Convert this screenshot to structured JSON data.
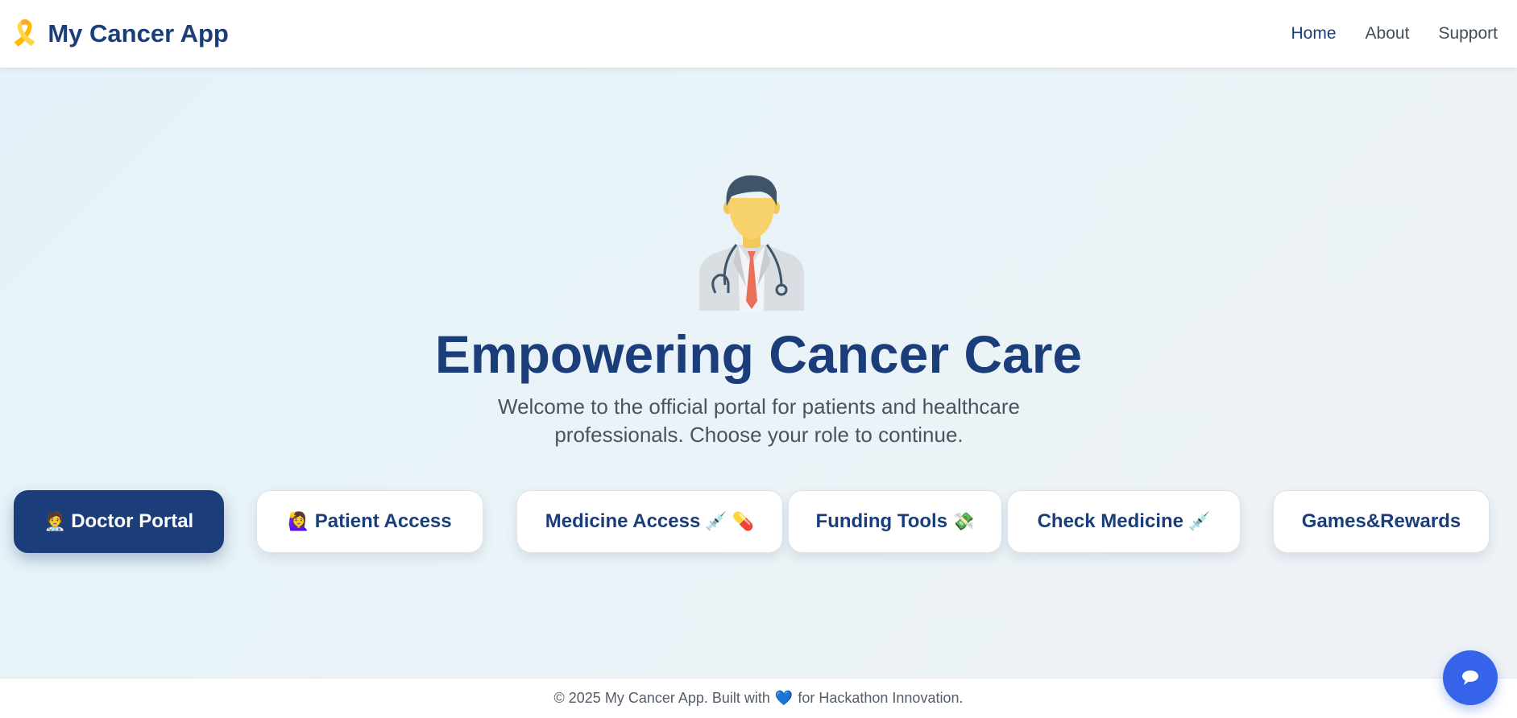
{
  "brand": {
    "icon": "ribbon-icon",
    "icon_glyph": "🎗️",
    "title": "My Cancer App"
  },
  "nav": {
    "links": [
      {
        "label": "Home",
        "active": true
      },
      {
        "label": "About",
        "active": false
      },
      {
        "label": "Support",
        "active": false
      }
    ]
  },
  "hero": {
    "illustration": "doctor-icon",
    "title": "Empowering Cancer Care",
    "subtitle": "Welcome to the official portal for patients and healthcare professionals. Choose your role to continue."
  },
  "roles": [
    {
      "label": "Doctor Portal",
      "emoji_before": "🧑‍⚕️",
      "emoji_after": ""
    },
    {
      "label": "Patient Access",
      "emoji_before": "🙋‍♀️",
      "emoji_after": ""
    },
    {
      "label": "Medicine Access",
      "emoji_before": "",
      "emoji_after": "💉 💊"
    },
    {
      "label": "Funding Tools",
      "emoji_before": "",
      "emoji_after": "💸"
    },
    {
      "label": "Check Medicine",
      "emoji_before": "",
      "emoji_after": "💉"
    },
    {
      "label": "Games&Rewards",
      "emoji_before": "",
      "emoji_after": ""
    }
  ],
  "footer": {
    "prefix": "© 2025 My Cancer App. Built with",
    "heart_glyph": "💙",
    "suffix": "for Hackathon Innovation."
  },
  "chat": {
    "icon": "chat-bubble-icon"
  },
  "colors": {
    "brand_navy": "#1b3d7a",
    "chat_blue": "#3563e9",
    "page_bg": "#eaf3f7"
  }
}
